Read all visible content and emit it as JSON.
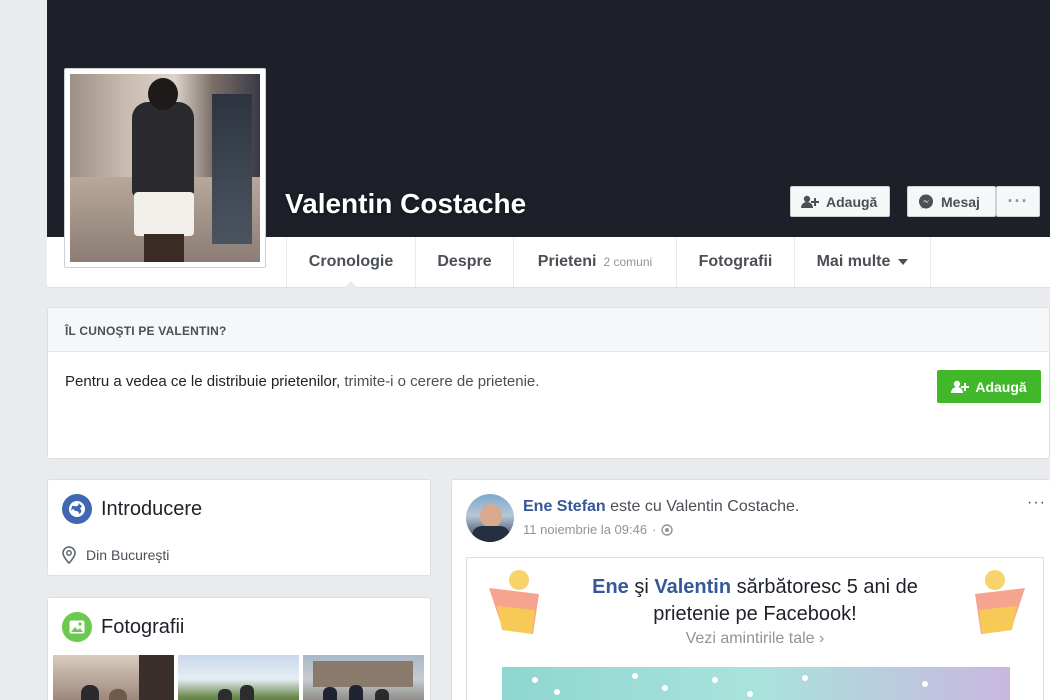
{
  "profile": {
    "name": "Valentin Costache",
    "add_friend_label": "Adaugă",
    "message_label": "Mesaj",
    "more_label": "···"
  },
  "tabs": [
    {
      "label": "Cronologie"
    },
    {
      "label": "Despre"
    },
    {
      "label": "Prieteni",
      "sub": "2 comuni"
    },
    {
      "label": "Fotografii"
    },
    {
      "label": "Mai multe"
    }
  ],
  "know_box": {
    "title": "ÎL CUNOŞTI PE VALENTIN?",
    "text": "Pentru a vedea ce le distribuie prietenilor,",
    "link": "trimite-i o cerere de prietenie.",
    "button_label": "Adaugă"
  },
  "intro": {
    "title": "Introducere",
    "prefix": "Din",
    "city": "Bucureşti"
  },
  "photos": {
    "title": "Fotografii"
  },
  "post": {
    "author": "Ene Stefan",
    "connector": "este cu",
    "tagged": "Valentin Costache.",
    "timestamp": "11 noiembrie la 09:46",
    "more_label": "···",
    "memory": {
      "name1": "Ene",
      "and": "şi",
      "name2": "Valentin",
      "text_rest": "sărbătoresc 5 ani de",
      "line2": "prietenie pe Facebook!",
      "link": "Vezi amintirile tale"
    }
  },
  "colors": {
    "cover": "#1d2029",
    "link_blue": "#365899",
    "green": "#42b72a",
    "background": "#e9ebee"
  }
}
